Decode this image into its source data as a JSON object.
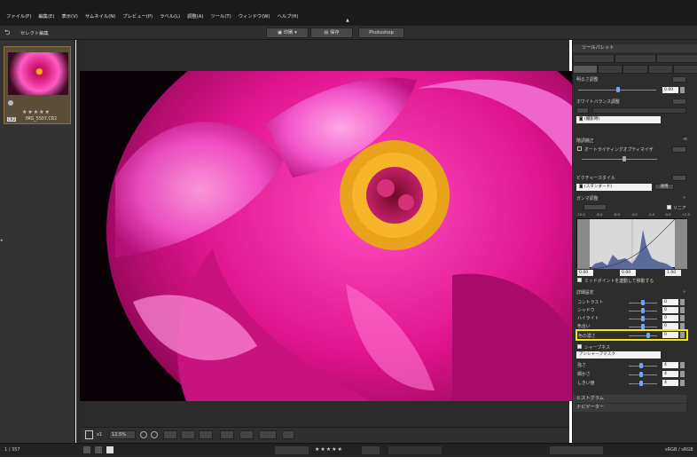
{
  "menu": {
    "items": [
      "ファイル(F)",
      "編集(E)",
      "表示(V)",
      "サムネイル(N)",
      "プレビュー(P)",
      "ラベル(L)",
      "調整(A)",
      "ツール(T)",
      "ウィンドウ(W)",
      "ヘルプ(H)"
    ]
  },
  "toolbar": {
    "back_label": "セレクト編集",
    "print_label": "印刷",
    "save_label": "保存",
    "photoshop_label": "Photoshop"
  },
  "filmstrip": {
    "filename": "IMG_5507.CR2",
    "rating": "★★★★★",
    "badge": "CR2"
  },
  "viewer_toolbar": {
    "zoom_label": "x1",
    "zoom_value": "12.5%"
  },
  "panel": {
    "header": "ツールパレット",
    "brightness_title": "明るさ調整",
    "brightness_value": "0.00",
    "wb_title": "ホワイトバランス調整",
    "wb_select": "(撮影時)",
    "dynamic_title": "階調補正",
    "auto_lighting": "オートライティングオプティマイザ",
    "picture_style_title": "ピクチャースタイル",
    "picture_style_select": "(スタンダード)",
    "apply": "適用",
    "gamma_title": "ガンマ調整",
    "gamma_linear": "リニア",
    "gamma_scale": [
      "-10.0",
      "-8.0",
      "-6.0",
      "-4.0",
      "-2.0",
      "0.0",
      "+2.0"
    ],
    "gamma_values": [
      "0.00",
      "0.00",
      "1.00"
    ],
    "midpoint_label": "ミッドポイントを連動して移動する",
    "detail_title": "詳細設定",
    "detail_rows": [
      {
        "label": "コントラスト",
        "value": "0"
      },
      {
        "label": "シャドウ",
        "value": "0"
      },
      {
        "label": "ハイライト",
        "value": "0"
      },
      {
        "label": "色合い",
        "value": "0"
      },
      {
        "label": "色の濃さ",
        "value": "0"
      }
    ],
    "sharpness_title": "シャープネス",
    "sharpness_select": "アンシャープマスク",
    "sharp_rows": [
      {
        "label": "強さ",
        "value": "4"
      },
      {
        "label": "細かさ",
        "value": "4"
      },
      {
        "label": "しきい値",
        "value": "4"
      }
    ],
    "histogram_label": "ヒストグラム",
    "navigator_label": "ナビゲーター"
  },
  "status": {
    "left_count": "1 / 357",
    "color_space": "sRGB / sRGB",
    "rating": "★★★★★"
  },
  "colors": {
    "highlight": "#f2e90a",
    "accent_blue": "#6fa3ff"
  }
}
